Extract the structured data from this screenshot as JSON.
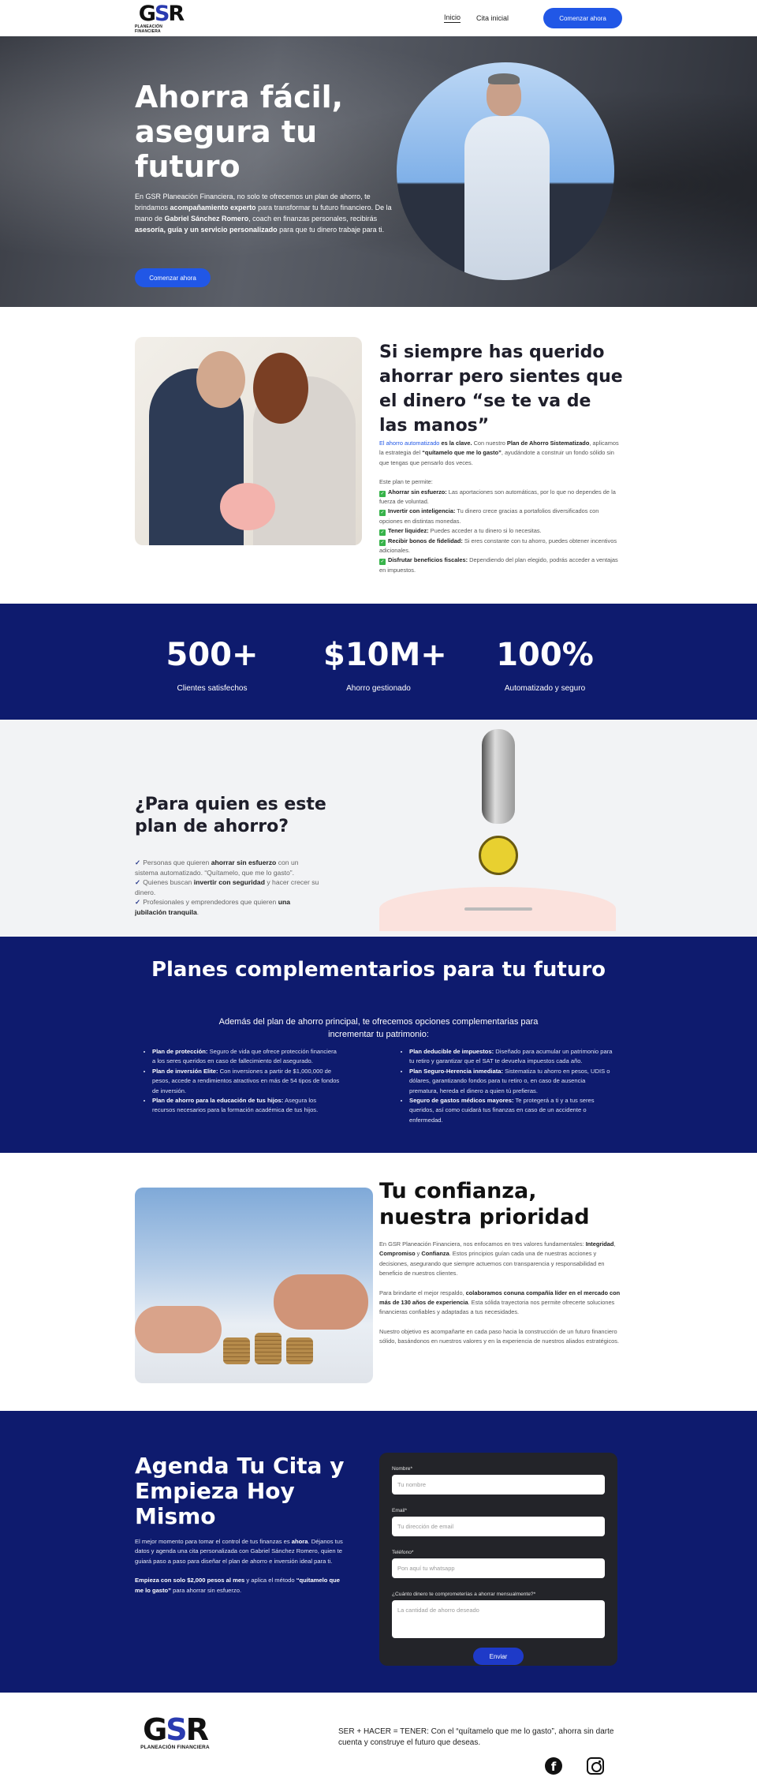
{
  "header": {
    "logo_text": "GSR",
    "logo_sub": "PLANEACIÓN FINANCIERA",
    "nav": [
      "Inicio",
      "Cita inicial"
    ],
    "cta": "Comenzar ahora"
  },
  "hero": {
    "title": "Ahorra fácil, asegura tu futuro",
    "p1": "En GSR Planeación Financiera, no solo te ofrecemos un plan de ahorro, te brindamos ",
    "p1_b": "acompañamiento experto",
    "p2": " para transformar tu futuro financiero. De la mano de ",
    "p2_b": "Gabriel Sánchez Romero",
    "p3": ", coach en finanzas personales, recibirás ",
    "p3_b": "asesoría, guía y un servicio personalizado",
    "p4": " para que tu dinero trabaje para ti.",
    "cta": "Comenzar ahora"
  },
  "savings": {
    "title": "Si siempre has querido ahorrar pero sientes que el dinero “se te va de las manos”",
    "intro_blue": "El ahorro automatizado",
    "intro_b1": " es la clave.",
    "intro_1": " Con nuestro ",
    "intro_b2": "Plan de Ahorro Sistematizado",
    "intro_2": ", aplicamos la estrategia del ",
    "intro_b3": "“quítamelo que me lo gasto”",
    "intro_3": ", ayudándote a construir un fondo sólido sin que tengas que pensarlo dos veces.",
    "list_intro": "Este plan te permite:",
    "items": [
      {
        "b": "Ahorrar sin esfuerzo:",
        "t": " Las aportaciones son automáticas, por lo que no dependes de la fuerza de voluntad."
      },
      {
        "b": "Invertir con inteligencia:",
        "t": " Tu dinero crece gracias a portafolios diversificados con opciones en distintas monedas."
      },
      {
        "b": "Tener liquidez:",
        "t": " Puedes acceder a tu dinero si lo necesitas."
      },
      {
        "b": "Recibir bonos de fidelidad:",
        "t": " Si eres constante con tu ahorro, puedes obtener incentivos adicionales."
      },
      {
        "b": "Disfrutar beneficios fiscales:",
        "t": " Dependiendo del plan elegido, podrás acceder a ventajas en impuestos."
      }
    ]
  },
  "stats": [
    {
      "value": "500+",
      "label": "Clientes satisfechos"
    },
    {
      "value": "$10M+",
      "label": "Ahorro gestionado"
    },
    {
      "value": "100%",
      "label": "Automatizado y seguro"
    }
  ],
  "who": {
    "title": "¿Para quien es este plan de ahorro?",
    "items": [
      {
        "a": "Personas que quieren ",
        "b": "ahorrar sin esfuerzo",
        "c": " con un sistema automatizado. “Quítamelo, que me lo gasto”."
      },
      {
        "a": "Quienes buscan ",
        "b": "invertir con seguridad",
        "c": " y hacer crecer su dinero."
      },
      {
        "a": "Profesionales y emprendedores que quieren ",
        "b": "una jubilación tranquila",
        "c": "."
      }
    ]
  },
  "plans": {
    "title": "Planes complementarios para tu futuro",
    "subtitle": "Además del plan de ahorro principal, te ofrecemos opciones complementarias para incrementar tu patrimonio:",
    "left": [
      {
        "b": "Plan de protección:",
        "t": " Seguro de vida que ofrece protección financiera a los seres queridos en caso de fallecimiento del asegurado."
      },
      {
        "b": "Plan de inversión Elite:",
        "t": " Con inversiones a partir de $1,000,000 de pesos, accede a rendimientos atractivos en más de 54 tipos de fondos de inversión."
      },
      {
        "b": "Plan de ahorro para la educación de tus hijos:",
        "t": " Asegura los recursos necesarios para la formación académica de tus hijos."
      }
    ],
    "right": [
      {
        "b": "Plan deducible de impuestos:",
        "t": " Diseñado para acumular un patrimonio para tu retiro y garantizar que el SAT te devuelva impuestos cada año."
      },
      {
        "b": "Plan Seguro-Herencia inmediata:",
        "t": " Sistematiza tu ahorro en pesos, UDIS o dólares, garantizando fondos para tu retiro o, en caso de ausencia prematura, hereda el dinero a quien tú prefieras."
      },
      {
        "b": "Seguro de gastos médicos mayores:",
        "t": " Te protegerá a ti y a tus seres queridos, así como cuidará tus finanzas en caso de un accidente o enfermedad."
      }
    ]
  },
  "trust": {
    "title": "Tu confianza, nuestra prioridad",
    "p1a": "En GSR Planeación Financiera, nos enfocamos en tres valores fundamentales: ",
    "p1b": "Integridad",
    "p1c": ", ",
    "p1d": "Compromiso",
    "p1e": " y ",
    "p1f": "Confianza",
    "p1g": ". Estos principios guían cada una de nuestras acciones y decisiones, asegurando que siempre actuemos con transparencia y responsabilidad en beneficio de nuestros clientes.",
    "p2a": "Para brindarte el mejor respaldo, ",
    "p2b": "colaboramos conuna compañía líder en el mercado con más de 130 años de experiencia",
    "p2c": ". Esta sólida trayectoria nos permite ofrecerte soluciones financieras confiables y adaptadas a tus necesidades.",
    "p3": "Nuestro objetivo es acompañarte en cada paso hacia la construcción de un futuro financiero sólido, basándonos en nuestros valores y en la experiencia de nuestros aliados estratégicos."
  },
  "appt": {
    "title": "Agenda Tu Cita y Empieza Hoy Mismo",
    "p1a": "El mejor momento para tomar el control de tus finanzas es ",
    "p1b": "ahora",
    "p1c": ". Déjanos tus datos y agenda una cita personalizada con Gabriel Sánchez Romero, quien te guiará paso a paso para diseñar el plan de ahorro e inversión ideal para ti.",
    "p2a": "Empieza con solo $2,000 pesos al mes",
    "p2b": " y aplica el método ",
    "p2c": "“quítamelo que me lo gasto”",
    "p2d": " para ahorrar sin esfuerzo.",
    "form": {
      "name_label": "Nombre*",
      "name_ph": "Tu nombre",
      "email_label": "Email*",
      "email_ph": "Tu dirección de email",
      "phone_label": "Teléfono*",
      "phone_ph": "Pon aquí tu whatsapp",
      "amount_label": "¿Cuánto dinero te comprometerías a ahorrar mensualmente?*",
      "amount_ph": "La cantidad de ahorro deseado",
      "submit": "Enviar"
    }
  },
  "footer": {
    "logo_text": "GSR",
    "logo_sub": "PLANEACIÓN FINANCIERA",
    "tagline": "SER + HACER = TENER: Con el “quítamelo que me lo gasto”, ahorra sin darte cuenta y construye el futuro que deseas."
  },
  "icons": [
    "logo",
    "check-icon",
    "tick-icon",
    "facebook-icon",
    "instagram-icon"
  ],
  "colors": {
    "brand_blue": "#2157e6",
    "navy": "#0e1b6e",
    "form_dark": "#232429",
    "check_green": "#37b34a"
  }
}
